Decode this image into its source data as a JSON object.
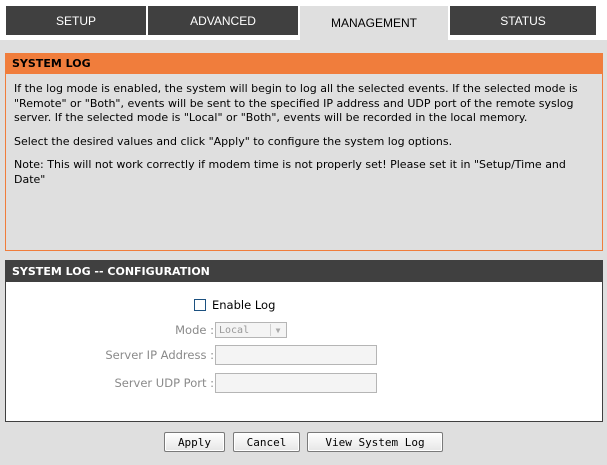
{
  "tabs": [
    {
      "label": "SETUP"
    },
    {
      "label": "ADVANCED"
    },
    {
      "label": "MANAGEMENT"
    },
    {
      "label": "STATUS"
    }
  ],
  "info": {
    "title": "SYSTEM LOG",
    "paragraphs": [
      "If the log mode is enabled, the system will begin to log all the selected events. If the selected mode is \"Remote\" or \"Both\", events will be sent to the specified IP address and UDP port of the remote syslog server. If the selected mode is \"Local\" or \"Both\", events will be recorded in the local memory.",
      "Select the desired values and click \"Apply\" to configure the system log options.",
      "Note: This will not work correctly if modem time is not properly set! Please set it in \"Setup/Time and Date\""
    ]
  },
  "config": {
    "title": "SYSTEM LOG -- CONFIGURATION",
    "enable_log_label": "Enable Log",
    "mode_label": "Mode :",
    "mode_value": "Local",
    "server_ip_label": "Server IP Address :",
    "server_ip_value": "",
    "server_port_label": "Server UDP Port :",
    "server_port_value": ""
  },
  "buttons": {
    "apply": "Apply",
    "cancel": "Cancel",
    "view_log": "View System Log"
  },
  "colors": {
    "accent": "#f07d3c",
    "tab_bg": "#404040",
    "page_bg": "#dfdfdf"
  }
}
